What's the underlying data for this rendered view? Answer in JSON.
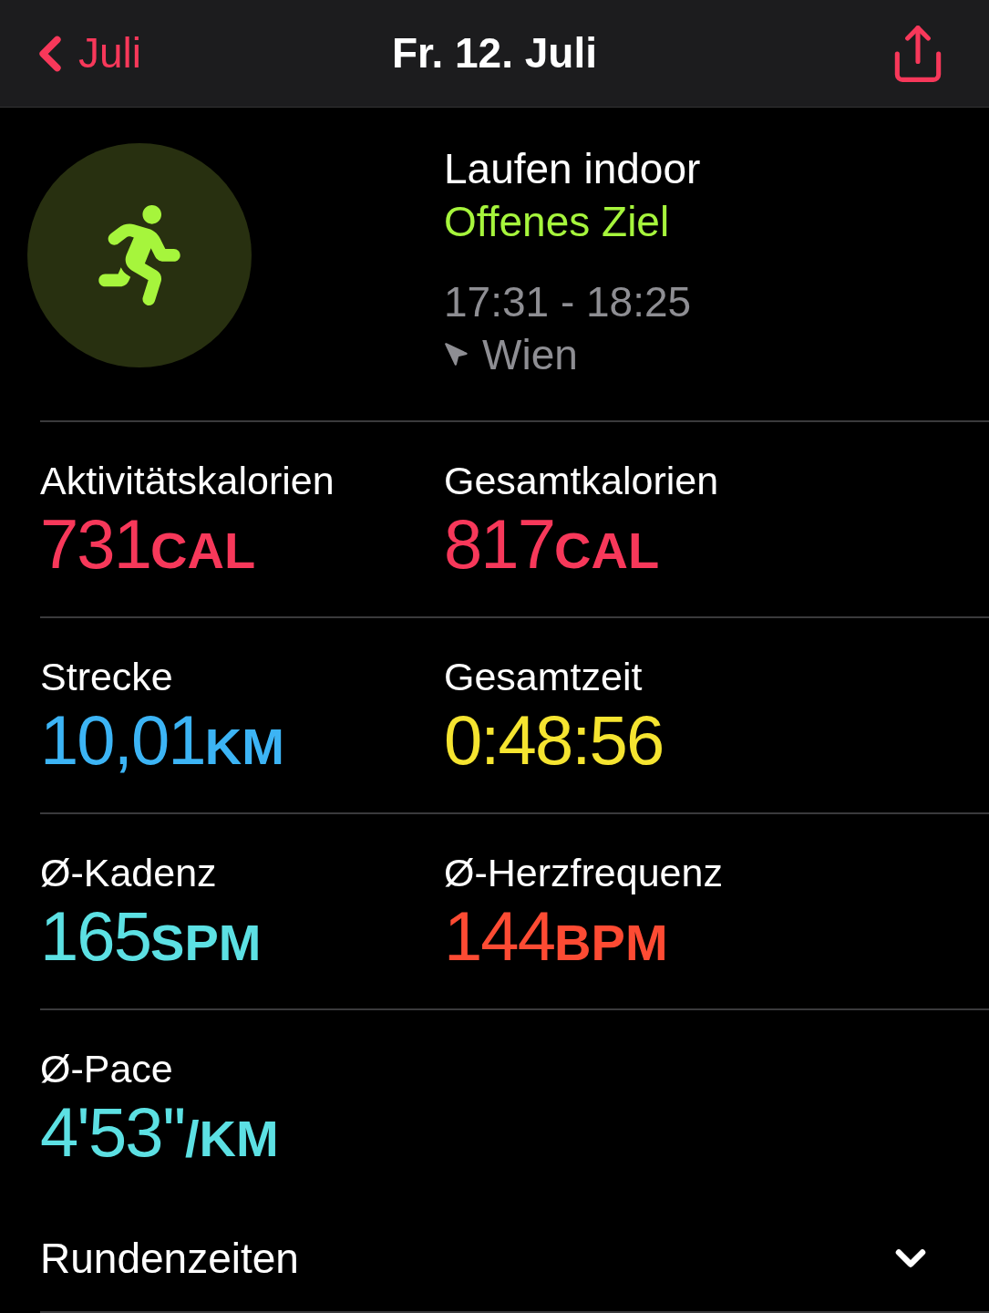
{
  "nav": {
    "back_label": "Juli",
    "title": "Fr. 12. Juli"
  },
  "workout": {
    "name": "Laufen indoor",
    "goal": "Offenes Ziel",
    "time_range": "17:31 - 18:25",
    "location": "Wien"
  },
  "metrics": [
    {
      "label": "Aktivitätskalorien",
      "value": "731",
      "unit": "CAL",
      "color": "#f7385a"
    },
    {
      "label": "Gesamtkalorien",
      "value": "817",
      "unit": "CAL",
      "color": "#f7385a"
    },
    {
      "label": "Strecke",
      "value": "10,01",
      "unit": "KM",
      "color": "#3cb4f5"
    },
    {
      "label": "Gesamtzeit",
      "value": "0:48:56",
      "color": "#f5e430"
    },
    {
      "label": "Ø-Kadenz",
      "value": "165",
      "unit": "SPM",
      "color": "#5ce0e3"
    },
    {
      "label": "Ø-Herzfrequenz",
      "value": "144",
      "unit": "BPM",
      "color": "#fd4b33"
    },
    {
      "label": "Ø-Pace",
      "value": "4'53''",
      "unit": "/KM",
      "color": "#5ce0e3"
    }
  ],
  "laps": {
    "label": "Rundenzeiten",
    "expanded": false
  }
}
